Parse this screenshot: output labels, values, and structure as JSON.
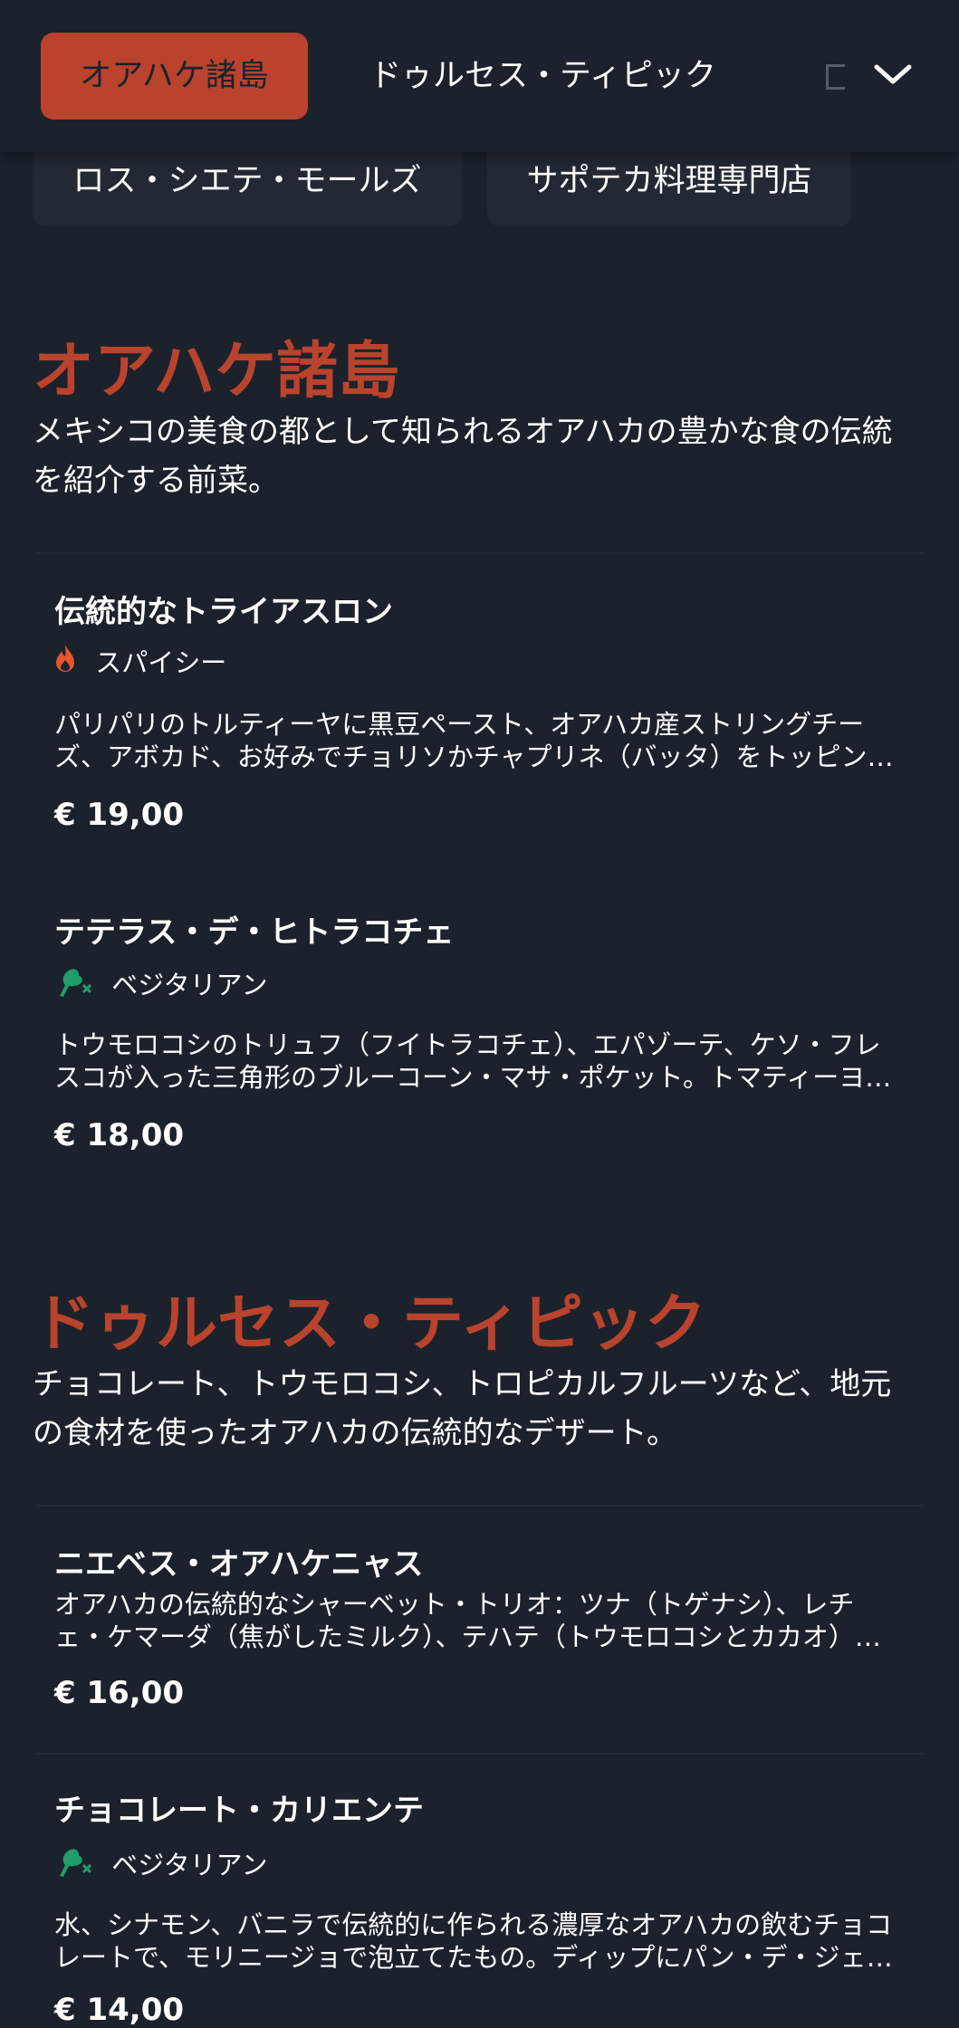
{
  "nav": {
    "tabs": [
      {
        "label": "オアハケ諸島",
        "active": true
      },
      {
        "label": "ドゥルセス・ティピック",
        "active": false
      }
    ],
    "chips": [
      {
        "label": "ロス・シエテ・モールズ"
      },
      {
        "label": "サポテカ料理専門店"
      }
    ]
  },
  "sections": [
    {
      "title": "オアハケ諸島",
      "description": "メキシコの美食の都として知られるオアハカの豊かな食の伝統を紹介する前菜。",
      "items": [
        {
          "name": "伝統的なトライアスロン",
          "tag": {
            "label": "スパイシー",
            "icon": "flame-icon"
          },
          "description": "パリパリのトルティーヤに黒豆ペースト、オアハカ産ストリングチーズ、アボカド、お好みでチョリソかチャプリネ（バッタ）をトッピング。",
          "price": "€ 19,00"
        },
        {
          "name": "テテラス・デ・ヒトラコチェ",
          "tag": {
            "label": "ベジタリアン",
            "icon": "vegetarian-icon"
          },
          "description": "トウモロコシのトリュフ（フイトラコチェ）、エパゾーテ、ケソ・フレスコが入った三角形のブルーコーン・マサ・ポケット。トマティーヨサルサ添え。",
          "price": "€ 18,00"
        }
      ]
    },
    {
      "title": "ドゥルセス・ティピック",
      "description": "チョコレート、トウモロコシ、トロピカルフルーツなど、地元の食材を使ったオアハカの伝統的なデザート。",
      "items": [
        {
          "name": "ニエベス・オアハケニャス",
          "description": "オアハカの伝統的なシャーベット・トリオ：ツナ（トゲナシ）、レチェ・ケマーダ（焦がしたミルク）、テハテ（トウモロコシとカカオ）のシャーベット。",
          "price": "€ 16,00"
        },
        {
          "name": "チョコレート・カリエンテ",
          "tag": {
            "label": "ベジタリアン",
            "icon": "vegetarian-icon"
          },
          "description": "水、シナモン、バニラで伝統的に作られる濃厚なオアハカの飲むチョコレートで、モリニージョで泡立てたもの。ディップにパン・デ・ジェマを添えて。",
          "price": "€ 14,00"
        }
      ]
    }
  ],
  "colors": {
    "background": "#1b222c",
    "accent": "#b9432c",
    "vegetarian": "#1f9e6b",
    "flame": "#e8552a"
  }
}
